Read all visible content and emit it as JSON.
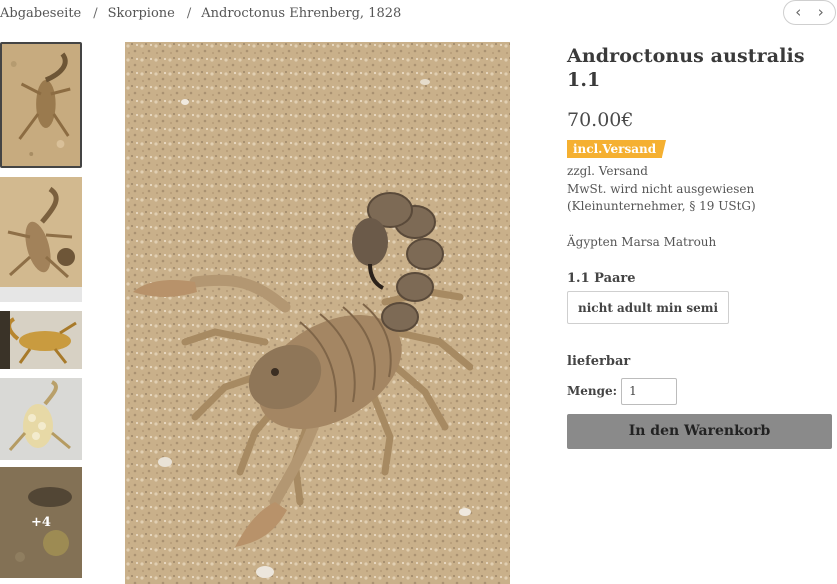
{
  "breadcrumb": {
    "items": [
      "Abgabeseite",
      "Skorpione",
      "Androctonus Ehrenberg, 1828"
    ],
    "separator": "/"
  },
  "nav": {
    "prev_icon": "chevron-left-icon",
    "next_icon": "chevron-right-icon"
  },
  "gallery": {
    "more_label": "+4"
  },
  "product": {
    "title": "Androctonus australis 1.1",
    "price": "70.00€",
    "badge": "incl.Versand",
    "badge_color": "#f5b031",
    "shipping": "zzgl. Versand",
    "tax_line1": "MwSt. wird nicht ausgewiesen",
    "tax_line2": "(Kleinunternehmer, § 19 UStG)",
    "origin": "Ägypten Marsa Matrouh",
    "variant_label": "1.1 Paare",
    "variant_value": "nicht adult min semi",
    "availability": "lieferbar",
    "quantity_label": "Menge:",
    "quantity_value": "1",
    "cart_button": "In den Warenkorb"
  }
}
